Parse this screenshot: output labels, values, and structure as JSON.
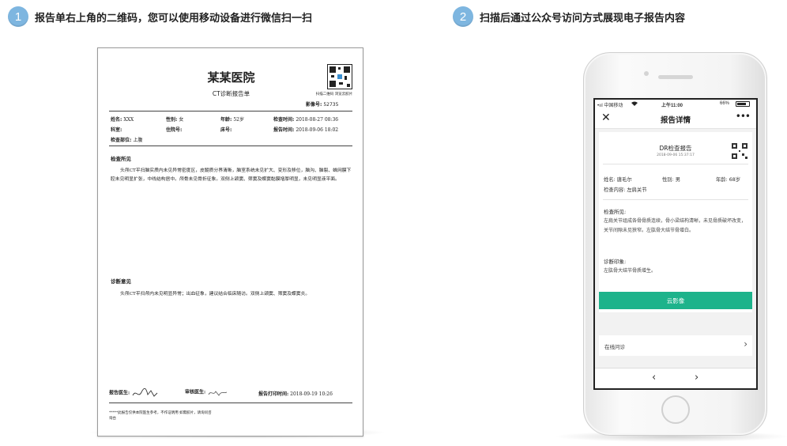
{
  "steps": [
    {
      "number": "1",
      "text": "报告单右上角的二维码，您可以使用移动设备进行微信扫一扫"
    },
    {
      "number": "2",
      "text": "扫描后通过公众号访问方式展现电子报告内容"
    }
  ],
  "paper": {
    "hospital": "某某医院",
    "subtitle": "CT诊断报告单",
    "qr_caption": "扫描二维码 浏览云胶片",
    "image_no_label": "影像号:",
    "image_no": "52735",
    "name_label": "姓名:",
    "name": "XXX",
    "gender_label": "性别:",
    "gender": "女",
    "age_label": "年龄:",
    "age": "52岁",
    "exam_time_label": "检查时间:",
    "exam_time": "2018-08-27 08:36",
    "dept_label": "科室:",
    "ward_label": "住院号:",
    "bed_label": "床号:",
    "report_time_label": "报告时间:",
    "report_time": "2018-09-06 18:02",
    "part_label": "检查部位:",
    "part": "上腹",
    "findings_title": "检查所见",
    "findings": "头颅CT平扫脑实质内未见异常密度区，皮髓质分界清晰，脑室系统未见扩大、变形及移位，脑沟、脑裂、蛛网膜下腔未见明显扩张，中线结构居中。颅骨未见骨折征象。双侧上颌窦、筛窦及蝶窦黏膜增厚明显，未见明显液平面。",
    "impression_title": "诊断意见",
    "impression": "头颅CT平扫颅内未见明显异常；出血征象，建议结合临床随访。双侧上颌窦、筛窦及蝶窦炎。",
    "doctor_label": "报告医生:",
    "reviewer_label": "审核医生:",
    "print_time_label": "报告打印时间:",
    "print_time": "2018-09-19 10:26",
    "footnote": "*****此报告仅供本院医生参考，不作证明用 如需胶片，请询问咨询台"
  },
  "phone": {
    "status": {
      "carrier": "•ııl 中国移动",
      "wifi": "wifi-icon",
      "time": "上午11:00",
      "battery": "66%"
    },
    "nav_title": "报告详情",
    "card": {
      "title": "DR检查报告",
      "date": "2018-09-06 15:37:17",
      "name_label": "姓名:",
      "name": "唐毛尔",
      "gender_label": "性别:",
      "gender": "男",
      "age_label": "年龄:",
      "age": "68岁",
      "exam_label": "检查内容:",
      "exam": "左肩关节",
      "findings_title": "检查所见:",
      "findings": "左肩关节组成各骨骨质连续，骨小梁结构清晰，未见骨质破坏改变，关节间隙未见狭窄。左肱骨大结节骨增白。",
      "impression_title": "诊断印象:",
      "impression": "左肱骨大结节骨质增生。"
    },
    "cloud_button": "云影像",
    "online_label": "在线问诊"
  },
  "colors": {
    "badge": "#7eb6e0",
    "accent": "#1db38b"
  }
}
